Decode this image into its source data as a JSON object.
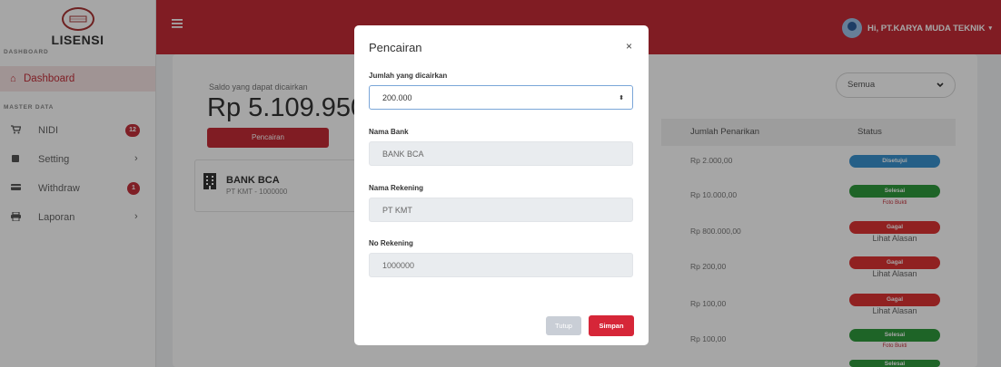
{
  "sidebar": {
    "brand": "LISENSI",
    "logo_text": "LISENSI",
    "section_dashboard": "DASHBOARD",
    "dashboard_label": "Dashboard",
    "section_master": "MASTER DATA",
    "items": [
      {
        "label": "NIDI",
        "badge": "12",
        "icon": "cart-icon"
      },
      {
        "label": "Setting",
        "chevron": "›",
        "icon": "gear-icon"
      },
      {
        "label": "Withdraw",
        "badge": "1",
        "icon": "card-icon"
      },
      {
        "label": "Laporan",
        "chevron": "›",
        "icon": "printer-icon"
      }
    ]
  },
  "topbar": {
    "user_greeting": "Hi, PT.KARYA MUDA TEKNIK",
    "caret": "▾",
    "color": "#c52c36"
  },
  "main": {
    "saldo_label": "Saldo yang dapat dicairkan",
    "saldo_value": "Rp 5.109.950,",
    "pencairan_button": "Pencairan",
    "bank": {
      "name": "BANK BCA",
      "account": "PT KMT - 1000000"
    },
    "filter": {
      "value": "Semua"
    },
    "table": {
      "headers": [
        "Jumlah Penarikan",
        "Status"
      ],
      "rows": [
        {
          "amount": "Rp 2.000,00",
          "status": "Disetujui",
          "status_color": "blue",
          "sub": ""
        },
        {
          "amount": "Rp 10.000,00",
          "status": "Selesai",
          "status_color": "green",
          "sub": "Foto Bukti"
        },
        {
          "amount": "Rp 800.000,00",
          "status": "Gagal",
          "status_color": "red",
          "sub": "Lihat Alasan"
        },
        {
          "amount": "Rp 200,00",
          "status": "Gagal",
          "status_color": "red",
          "sub": "Lihat Alasan"
        },
        {
          "amount": "Rp 100,00",
          "status": "Gagal",
          "status_color": "red",
          "sub": "Lihat Alasan"
        },
        {
          "amount": "Rp 100,00",
          "status": "Selesai",
          "status_color": "green",
          "sub": "Foto Bukti"
        },
        {
          "amount": "",
          "status": "Selesai",
          "status_color": "green",
          "sub": ""
        }
      ]
    }
  },
  "modal": {
    "title": "Pencairan",
    "close": "×",
    "fields": [
      {
        "label": "Jumlah yang dicairkan",
        "value": "200.000"
      },
      {
        "label": "Nama Bank",
        "value": "BANK BCA"
      },
      {
        "label": "Nama Rekening",
        "value": "PT KMT"
      },
      {
        "label": "No Rekening",
        "value": "1000000"
      }
    ],
    "tutup_label": "Tutup",
    "simpan_label": "Simpan"
  }
}
